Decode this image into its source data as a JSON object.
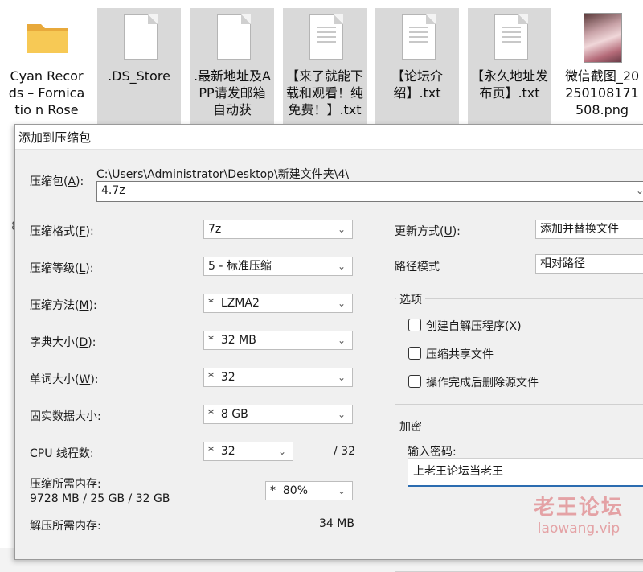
{
  "explorer": {
    "files": [
      {
        "name": "Cyan Records – Fornicatio n Rose",
        "icon": "folder-icon"
      },
      {
        "name": ".DS_Store",
        "icon": "file-icon"
      },
      {
        "name": ".最新地址及APP请发邮箱自动获取！！！",
        "icon": "file-icon"
      },
      {
        "name": "【来了就能下载和观看！纯免费！】.txt",
        "icon": "text-file-icon"
      },
      {
        "name": "【论坛介绍】.txt",
        "icon": "text-file-icon"
      },
      {
        "name": "【永久地址发布页】.txt",
        "icon": "text-file-icon"
      },
      {
        "name": "微信截图_20250108171508.png",
        "icon": "image-thumbnail-icon"
      }
    ],
    "edge_glyph": "8"
  },
  "dialog": {
    "title": "添加到压缩包",
    "archive_label": "压缩包(",
    "archive_key": "A",
    "archive_label_end": "):",
    "archive_path": "C:\\Users\\Administrator\\Desktop\\新建文件夹\\4\\",
    "archive_name": "4.7z",
    "format": {
      "label": "压缩格式(",
      "key": "F",
      "end": "):",
      "value": "7z"
    },
    "level": {
      "label": "压缩等级(",
      "key": "L",
      "end": "):",
      "value": "5 - 标准压缩"
    },
    "method": {
      "label": "压缩方法(",
      "key": "M",
      "end": "):",
      "value": "*  LZMA2"
    },
    "dict": {
      "label": "字典大小(",
      "key": "D",
      "end": "):",
      "value": "*  32 MB"
    },
    "word": {
      "label": "单词大小(",
      "key": "W",
      "end": "):",
      "value": "*  32"
    },
    "solid": {
      "label": "固实数据大小:",
      "value": "*  8 GB"
    },
    "cpu": {
      "label": "CPU 线程数:",
      "value": "*  32",
      "max": "/ 32"
    },
    "mem_compress": {
      "label": "压缩所需内存:",
      "value": "9728 MB / 25 GB / 32 GB",
      "percent": "*  80%"
    },
    "mem_decompress": {
      "label": "解压所需内存:",
      "value": "34 MB"
    },
    "update": {
      "label": "更新方式(",
      "key": "U",
      "end": "):",
      "value": "添加并替换文件"
    },
    "pathmode": {
      "label": "路径模式",
      "value": "相对路径"
    },
    "options": {
      "title": "选项",
      "sfx": {
        "label": "创建自解压程序(",
        "key": "X",
        "end": ")"
      },
      "shared": {
        "label": "压缩共享文件"
      },
      "delete_after": {
        "label": "操作完成后删除源文件"
      }
    },
    "encryption": {
      "title": "加密",
      "password_label": "输入密码:",
      "password_value": "上老王论坛当老王"
    }
  },
  "watermark": {
    "line1": "老王论坛",
    "line2": "laowang.vip"
  },
  "colors": {
    "accent": "#2b6cb0",
    "selected_tile": "#d9d9d9",
    "watermark": "#e4a2a5"
  }
}
